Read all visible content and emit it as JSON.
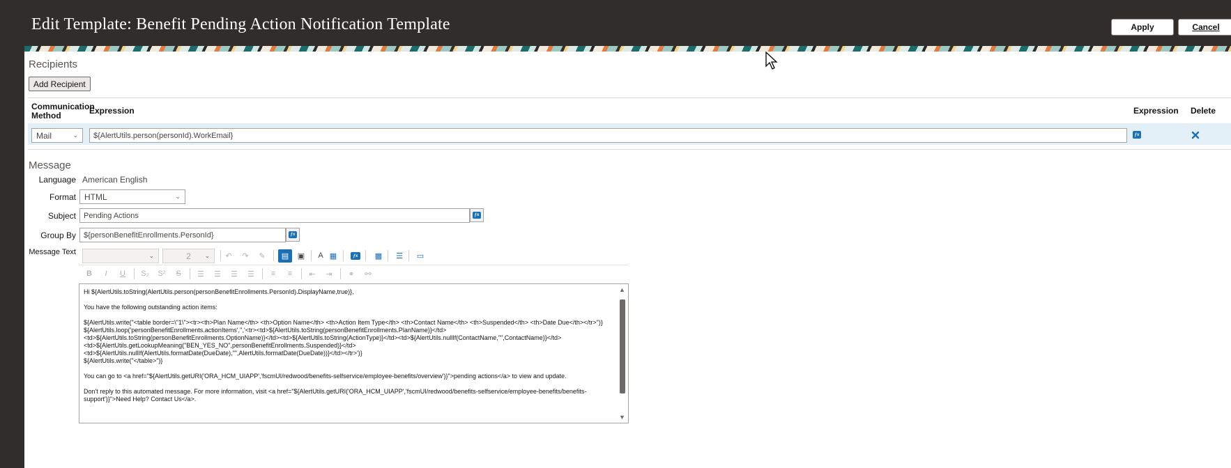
{
  "header": {
    "title": "Edit Template: Benefit Pending Action Notification Template",
    "apply_label": "Apply",
    "cancel_label": "Cancel"
  },
  "recipients": {
    "section_title": "Recipients",
    "add_button_label": "Add Recipient",
    "columns": {
      "communication_method": "Communication Method",
      "expression": "Expression",
      "expression_icon": "Expression",
      "delete": "Delete"
    },
    "rows": [
      {
        "communication_method": "Mail",
        "expression": "${AlertUtils.person(personId).WorkEmail}"
      }
    ]
  },
  "message": {
    "section_title": "Message",
    "language_label": "Language",
    "language_value": "American English",
    "format_label": "Format",
    "format_value": "HTML",
    "subject_label": "Subject",
    "subject_value": "Pending Actions",
    "group_by_label": "Group By",
    "group_by_value": "${personBenefitEnrollments.PersonId}",
    "message_text_label": "Message Text",
    "font_size_value": "2",
    "body_lines": [
      "Hi ${AlertUtils.toString(AlertUtils.person(personBenefitEnrollments.PersonId).DisplayName,true)},",
      "",
      "You have the following outstanding action items:",
      "",
      "${AlertUtils.write(\"<table border=\\\"1\\\"><tr><th>Plan Name</th> <th>Option Name</th> <th>Action Item Type</th> <th>Contact Name</th> <th>Suspended</th> <th>Date Due</th></tr>\")}",
      "${AlertUtils.loop('personBenefitEnrollments.actionItems','','<tr><td>${AlertUtils.toString(personBenefitEnrollments.PlanName)}</td>",
      "<td>${AlertUtils.toString(personBenefitEnrollments.OptionName)}</td><td>${AlertUtils.toString(ActionType)}</td><td>${AlertUtils.nullIf(ContactName,\"\",ContactName)}</td>",
      "<td>${AlertUtils.getLookupMeaning(\"BEN_YES_NO\",personBenefitEnrollments.Suspended)}</td>",
      "<td>${AlertUtils.nullIf(AlertUtils.formatDate(DueDate),\"\",AlertUtils.formatDate(DueDate))}</td></tr>')}",
      "${AlertUtils.write(\"</table>\")}",
      "",
      "You can go to <a href=\"${AlertUtils.getURI('ORA_HCM_UIAPP','fscmUI/redwood/benefits-selfservice/employee-benefits/overview')}\">pending actions</a> to view and update.",
      "",
      "Don't reply to this automated message. For more information, visit <a href=\"${AlertUtils.getURI('ORA_HCM_UIAPP','fscmUI/redwood/benefits-selfservice/employee-benefits/benefits-support')}\">Need Help? Contact Us</a>."
    ]
  },
  "colors": {
    "header_bg": "#312d2a",
    "row_highlight": "#e4f0f7",
    "accent_blue": "#1a6fb5"
  }
}
